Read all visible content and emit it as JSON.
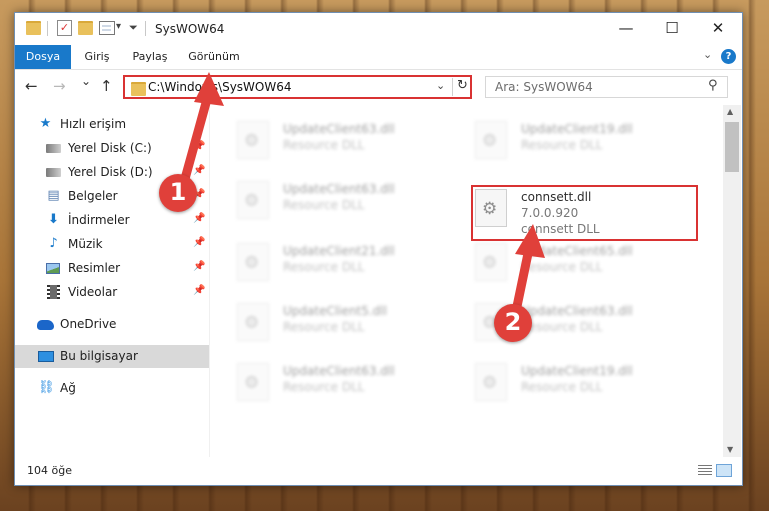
{
  "window": {
    "title": "SysWOW64",
    "minimize_glyph": "—",
    "maximize_glyph": "☐",
    "close_glyph": "✕"
  },
  "quick_access_toolbar": {
    "icons": [
      "folder-icon",
      "properties-checkmark-icon",
      "new-folder-icon",
      "customize-icon"
    ],
    "dropdown_glyph": "▾"
  },
  "ribbon": {
    "tabs": [
      "Dosya",
      "Giriş",
      "Paylaş",
      "Görünüm"
    ],
    "active_tab": "Dosya",
    "accent_color": "#1979ca",
    "expand_glyph": "⌄",
    "help_glyph": "?"
  },
  "navigation": {
    "back_glyph": "←",
    "forward_glyph": "→",
    "recent_glyph": "⌄",
    "up_glyph": "↑",
    "address_path": "C:\\Windows\\SysWOW64",
    "address_dropdown_glyph": "⌄",
    "refresh_glyph": "↻",
    "search_placeholder": "Ara: SysWOW64",
    "search_glyph": "⚲"
  },
  "sidebar": {
    "items": [
      {
        "label": "Hızlı erişim",
        "icon": "star-icon",
        "glyph": "★",
        "pinned": false
      },
      {
        "label": "Yerel Disk (C:)",
        "icon": "drive-icon",
        "glyph": "",
        "pinned": true
      },
      {
        "label": "Yerel Disk (D:)",
        "icon": "drive-icon",
        "glyph": "",
        "pinned": true
      },
      {
        "label": "Belgeler",
        "icon": "documents-icon",
        "glyph": "▤",
        "pinned": true
      },
      {
        "label": "İndirmeler",
        "icon": "download-icon",
        "glyph": "⬇",
        "pinned": true
      },
      {
        "label": "Müzik",
        "icon": "music-icon",
        "glyph": "♪",
        "pinned": true
      },
      {
        "label": "Resimler",
        "icon": "pictures-icon",
        "glyph": "",
        "pinned": true
      },
      {
        "label": "Videolar",
        "icon": "videos-icon",
        "glyph": "",
        "pinned": true
      },
      {
        "label": "OneDrive",
        "icon": "onedrive-icon",
        "glyph": "",
        "pinned": false
      },
      {
        "label": "Bu bilgisayar",
        "icon": "this-pc-icon",
        "glyph": "",
        "pinned": false,
        "selected": true
      },
      {
        "label": "Ağ",
        "icon": "network-icon",
        "glyph": "⛓",
        "pinned": false
      }
    ],
    "pin_glyph": "📌"
  },
  "files": [
    {
      "name": "UpdateClient63.dll",
      "line2": "Resource DLL",
      "line3": "",
      "blurred": true
    },
    {
      "name": "UpdateClient19.dll",
      "line2": "Resource DLL",
      "line3": "",
      "blurred": true
    },
    {
      "name": "UpdateClient63.dll",
      "line2": "Resource DLL",
      "line3": "",
      "blurred": true
    },
    {
      "name": "connsett.dll",
      "line2": "7.0.0.920",
      "line3": "connsett DLL",
      "blurred": false,
      "highlighted": true
    },
    {
      "name": "UpdateClient21.dll",
      "line2": "Resource DLL",
      "line3": "",
      "blurred": true
    },
    {
      "name": "UpdateClient65.dll",
      "line2": "Resource DLL",
      "line3": "",
      "blurred": true
    },
    {
      "name": "UpdateClient5.dll",
      "line2": "Resource DLL",
      "line3": "",
      "blurred": true
    },
    {
      "name": "UpdateClient63.dll",
      "line2": "Resource DLL",
      "line3": "",
      "blurred": true
    },
    {
      "name": "UpdateClient63.dll",
      "line2": "Resource DLL",
      "line3": "",
      "blurred": true
    },
    {
      "name": "UpdateClient19.dll",
      "line2": "Resource DLL",
      "line3": "",
      "blurred": true
    }
  ],
  "status_bar": {
    "item_count": "104 öğe",
    "view_icons": [
      "details-view-icon",
      "large-icons-view-icon"
    ]
  },
  "annotations": {
    "highlight_color": "#d93232",
    "badges": [
      "1",
      "2"
    ]
  },
  "scrollbar": {
    "up_glyph": "▲",
    "down_glyph": "▼"
  }
}
